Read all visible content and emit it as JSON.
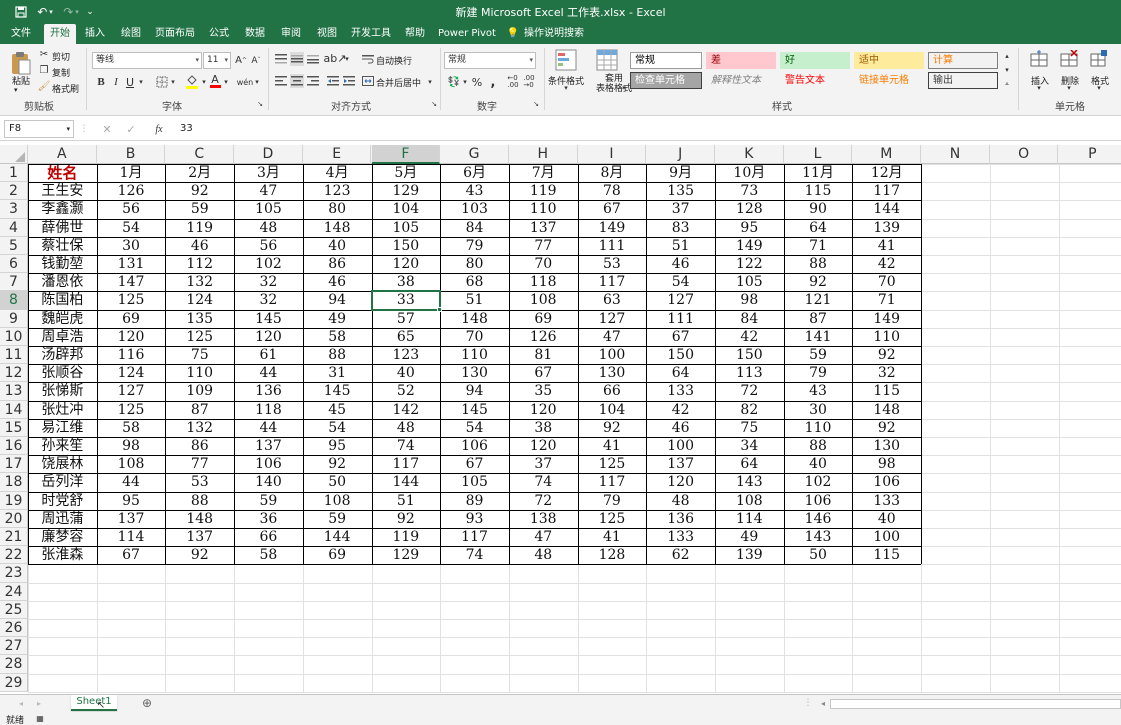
{
  "titlebar": {
    "title": "新建 Microsoft Excel 工作表.xlsx  -  Excel",
    "bg_color": "#217346"
  },
  "menu": {
    "tabs": [
      {
        "label": "文件",
        "active": false
      },
      {
        "label": "开始",
        "active": true
      },
      {
        "label": "插入",
        "active": false
      },
      {
        "label": "绘图",
        "active": false
      },
      {
        "label": "页面布局",
        "active": false
      },
      {
        "label": "公式",
        "active": false
      },
      {
        "label": "数据",
        "active": false
      },
      {
        "label": "审阅",
        "active": false
      },
      {
        "label": "视图",
        "active": false
      },
      {
        "label": "开发工具",
        "active": false
      },
      {
        "label": "帮助",
        "active": false
      },
      {
        "label": "Power Pivot",
        "active": false
      }
    ],
    "search_label": "操作说明搜索"
  },
  "ribbon": {
    "clipboard": {
      "paste": "粘贴",
      "cut": "剪切",
      "copy": "复制",
      "format_painter": "格式刷",
      "group": "剪贴板"
    },
    "font": {
      "name": "等线",
      "size": "11",
      "bold": "B",
      "italic": "I",
      "underline": "U",
      "group": "字体",
      "grow": "A",
      "shrink": "A",
      "phonetic": "wén"
    },
    "alignment": {
      "wrap": "自动换行",
      "merge": "合并后居中",
      "group": "对齐方式"
    },
    "number": {
      "format": "常规",
      "percent": "%",
      "comma": ",",
      "group": "数字"
    },
    "styles": {
      "conditional": "条件格式",
      "table": "套用\n表格格式",
      "group": "样式",
      "cells": [
        {
          "label": "常规",
          "color": "#000000",
          "bg": "#ffffff",
          "border": "#9c9c9c"
        },
        {
          "label": "差",
          "color": "#9c0006",
          "bg": "#ffc7ce",
          "border": "#ffc7ce"
        },
        {
          "label": "好",
          "color": "#006100",
          "bg": "#c6efce",
          "border": "#c6efce"
        },
        {
          "label": "适中",
          "color": "#9c5700",
          "bg": "#ffeb9c",
          "border": "#ffeb9c"
        },
        {
          "label": "计算",
          "color": "#fa7d00",
          "bg": "#f2f2f2",
          "border": "#7f7f7f"
        },
        {
          "label": "检查单元格",
          "color": "#ffffff",
          "bg": "#a5a5a5",
          "border": "#3f3f3f"
        },
        {
          "label": "解释性文本",
          "color": "#7f7f7f",
          "bg": "#f3f3f3",
          "border": "#f3f3f3"
        },
        {
          "label": "警告文本",
          "color": "#ff0000",
          "bg": "#f3f3f3",
          "border": "#f3f3f3"
        },
        {
          "label": "链接单元格",
          "color": "#fa7d00",
          "bg": "#f3f3f3",
          "border": "#f3f3f3"
        },
        {
          "label": "输出",
          "color": "#3f3f3f",
          "bg": "#f2f2f2",
          "border": "#3f3f3f"
        }
      ]
    },
    "cells": {
      "insert": "插入",
      "delete": "删除",
      "format": "格式",
      "group": "单元格"
    }
  },
  "formula_bar": {
    "name_box": "F8",
    "fx": "fx",
    "value": "33"
  },
  "sheet": {
    "columns": [
      "A",
      "B",
      "C",
      "D",
      "E",
      "F",
      "G",
      "H",
      "I",
      "J",
      "K",
      "L",
      "M",
      "N",
      "O",
      "P"
    ],
    "selected_column": "F",
    "selected_row": 8,
    "header_row": [
      "姓名",
      "1月",
      "2月",
      "3月",
      "4月",
      "5月",
      "6月",
      "7月",
      "8月",
      "9月",
      "10月",
      "11月",
      "12月"
    ],
    "header_name_color": "#c00000",
    "rows": [
      [
        "王生安",
        "126",
        "92",
        "47",
        "123",
        "129",
        "43",
        "119",
        "78",
        "135",
        "73",
        "115",
        "117"
      ],
      [
        "李鑫灏",
        "56",
        "59",
        "105",
        "80",
        "104",
        "103",
        "110",
        "67",
        "37",
        "128",
        "90",
        "144"
      ],
      [
        "薛佛世",
        "54",
        "119",
        "48",
        "148",
        "105",
        "84",
        "137",
        "149",
        "83",
        "95",
        "64",
        "139"
      ],
      [
        "蔡壮保",
        "30",
        "46",
        "56",
        "40",
        "150",
        "79",
        "77",
        "111",
        "51",
        "149",
        "71",
        "41"
      ],
      [
        "钱勤堃",
        "131",
        "112",
        "102",
        "86",
        "120",
        "80",
        "70",
        "53",
        "46",
        "122",
        "88",
        "42"
      ],
      [
        "潘恩依",
        "147",
        "132",
        "32",
        "46",
        "38",
        "68",
        "118",
        "117",
        "54",
        "105",
        "92",
        "70"
      ],
      [
        "陈国柏",
        "125",
        "124",
        "32",
        "94",
        "33",
        "51",
        "108",
        "63",
        "127",
        "98",
        "121",
        "71"
      ],
      [
        "魏皑虎",
        "69",
        "135",
        "145",
        "49",
        "57",
        "148",
        "69",
        "127",
        "111",
        "84",
        "87",
        "149"
      ],
      [
        "周卓浩",
        "120",
        "125",
        "120",
        "58",
        "65",
        "70",
        "126",
        "47",
        "67",
        "42",
        "141",
        "110"
      ],
      [
        "汤辟邦",
        "116",
        "75",
        "61",
        "88",
        "123",
        "110",
        "81",
        "100",
        "150",
        "150",
        "59",
        "92"
      ],
      [
        "张顺谷",
        "124",
        "110",
        "44",
        "31",
        "40",
        "130",
        "67",
        "130",
        "64",
        "113",
        "79",
        "32"
      ],
      [
        "张悌斯",
        "127",
        "109",
        "136",
        "145",
        "52",
        "94",
        "35",
        "66",
        "133",
        "72",
        "43",
        "115"
      ],
      [
        "张灶冲",
        "125",
        "87",
        "118",
        "45",
        "142",
        "145",
        "120",
        "104",
        "42",
        "82",
        "30",
        "148"
      ],
      [
        "易江维",
        "58",
        "132",
        "44",
        "54",
        "48",
        "54",
        "38",
        "92",
        "46",
        "75",
        "110",
        "92"
      ],
      [
        "孙来笙",
        "98",
        "86",
        "137",
        "95",
        "74",
        "106",
        "120",
        "41",
        "100",
        "34",
        "88",
        "130"
      ],
      [
        "饶展林",
        "108",
        "77",
        "106",
        "92",
        "117",
        "67",
        "37",
        "125",
        "137",
        "64",
        "40",
        "98"
      ],
      [
        "岳列洋",
        "44",
        "53",
        "140",
        "50",
        "144",
        "105",
        "74",
        "117",
        "120",
        "143",
        "102",
        "106"
      ],
      [
        "时党舒",
        "95",
        "88",
        "59",
        "108",
        "51",
        "89",
        "72",
        "79",
        "48",
        "108",
        "106",
        "133"
      ],
      [
        "周迅蒲",
        "137",
        "148",
        "36",
        "59",
        "92",
        "93",
        "138",
        "125",
        "136",
        "114",
        "146",
        "40"
      ],
      [
        "廉梦容",
        "114",
        "137",
        "66",
        "144",
        "119",
        "117",
        "47",
        "41",
        "133",
        "49",
        "143",
        "100"
      ],
      [
        "张淮森",
        "67",
        "92",
        "58",
        "69",
        "129",
        "74",
        "48",
        "128",
        "62",
        "139",
        "50",
        "115"
      ]
    ],
    "visible_rows": [
      "1",
      "2",
      "3",
      "4",
      "5",
      "6",
      "7",
      "8",
      "9",
      "10",
      "11",
      "12",
      "13",
      "14",
      "15",
      "16",
      "17",
      "18",
      "19",
      "20",
      "21",
      "22",
      "23",
      "24",
      "25",
      "26",
      "27",
      "28",
      "29"
    ]
  },
  "sheet_tabs": {
    "active": "Sheet1",
    "add": "⊕"
  },
  "status": {
    "mode": "就绪"
  }
}
